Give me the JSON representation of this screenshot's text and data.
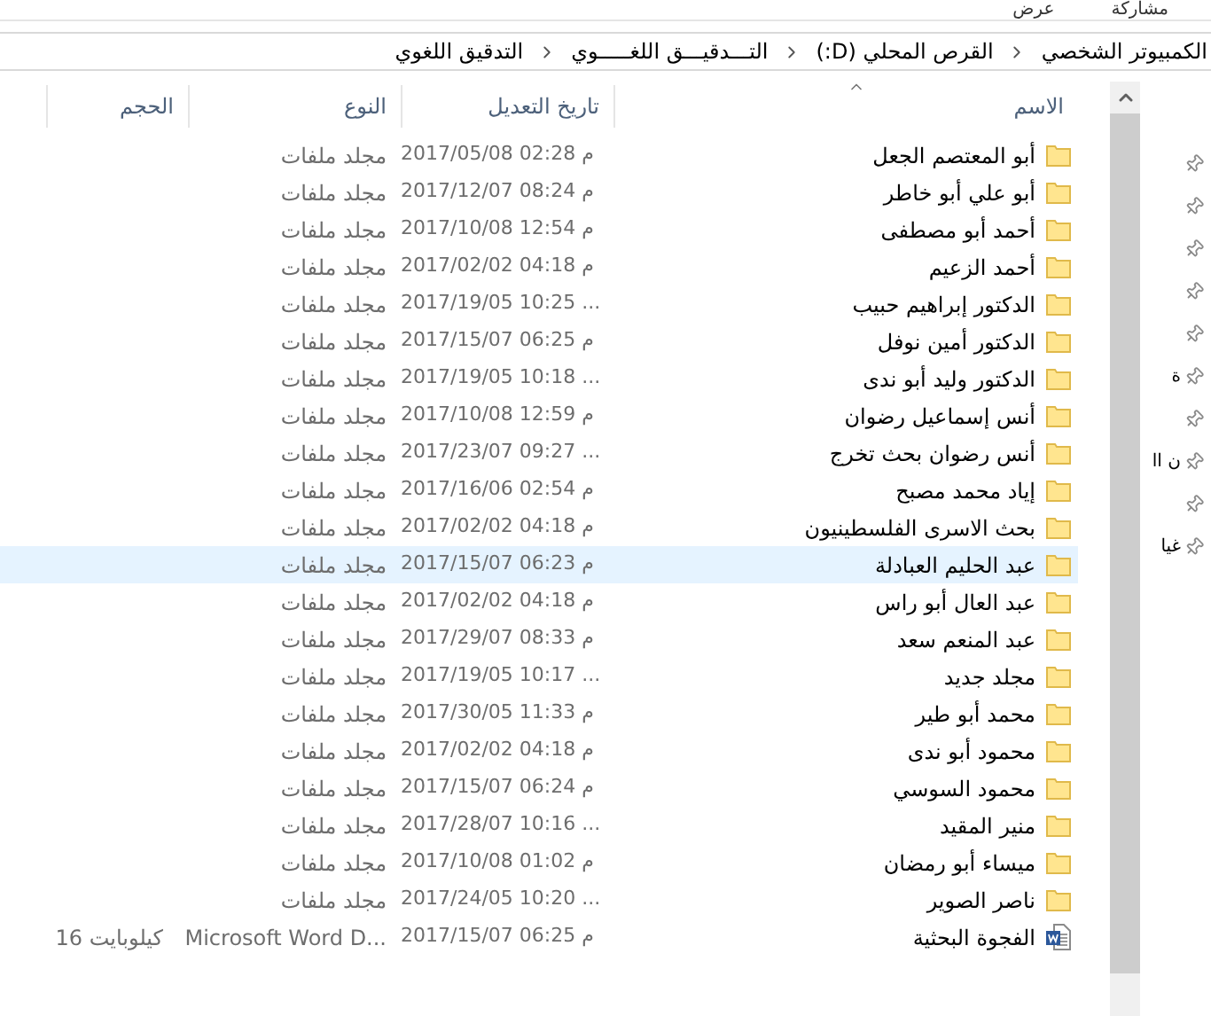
{
  "ribbon_tabs": [
    "مشاركة",
    "عرض"
  ],
  "breadcrumb": [
    "الكمبيوتر الشخصي",
    "القرص المحلي (D:)",
    "التـــدقيـــق اللغـــــوي",
    "التدقيق اللغوي"
  ],
  "columns": [
    {
      "label": "الاسم",
      "sorted": true
    },
    {
      "label": "تاريخ التعديل",
      "sorted": false
    },
    {
      "label": "النوع",
      "sorted": false
    },
    {
      "label": "الحجم",
      "sorted": false
    }
  ],
  "rows": [
    {
      "kind": "folder",
      "name": "أبو المعتصم الجعل",
      "modified": "2017/05/08 م 02:28",
      "type": "مجلد ملفات",
      "selected": false
    },
    {
      "kind": "folder",
      "name": "أبو علي أبو خاطر",
      "modified": "2017/12/07 م 08:24",
      "type": "مجلد ملفات",
      "selected": false
    },
    {
      "kind": "folder",
      "name": "أحمد أبو مصطفى",
      "modified": "2017/10/08 م 12:54",
      "type": "مجلد ملفات",
      "selected": false
    },
    {
      "kind": "folder",
      "name": "أحمد الزعيم",
      "modified": "2017/02/02 م 04:18",
      "type": "مجلد ملفات",
      "selected": false
    },
    {
      "kind": "folder",
      "name": "الدكتور إبراهيم حبيب",
      "modified": "2017/19/05 10:25 ...",
      "type": "مجلد ملفات",
      "selected": false
    },
    {
      "kind": "folder",
      "name": "الدكتور أمين نوفل",
      "modified": "2017/15/07 م 06:25",
      "type": "مجلد ملفات",
      "selected": false
    },
    {
      "kind": "folder",
      "name": "الدكتور وليد أبو ندى",
      "modified": "2017/19/05 10:18 ...",
      "type": "مجلد ملفات",
      "selected": false
    },
    {
      "kind": "folder",
      "name": "أنس إسماعيل رضوان",
      "modified": "2017/10/08 م 12:59",
      "type": "مجلد ملفات",
      "selected": false
    },
    {
      "kind": "folder",
      "name": "أنس رضوان بحث تخرج",
      "modified": "2017/23/07 09:27 ...",
      "type": "مجلد ملفات",
      "selected": false
    },
    {
      "kind": "folder",
      "name": "إياد محمد مصبح",
      "modified": "2017/16/06 م 02:54",
      "type": "مجلد ملفات",
      "selected": false
    },
    {
      "kind": "folder",
      "name": "بحث الاسرى الفلسطينيون",
      "modified": "2017/02/02 م 04:18",
      "type": "مجلد ملفات",
      "selected": false
    },
    {
      "kind": "folder",
      "name": "عبد الحليم العبادلة",
      "modified": "2017/15/07 م 06:23",
      "type": "مجلد ملفات",
      "selected": true
    },
    {
      "kind": "folder",
      "name": "عبد العال أبو راس",
      "modified": "2017/02/02 م 04:18",
      "type": "مجلد ملفات",
      "selected": false
    },
    {
      "kind": "folder",
      "name": "عبد المنعم سعد",
      "modified": "2017/29/07 م 08:33",
      "type": "مجلد ملفات",
      "selected": false
    },
    {
      "kind": "folder",
      "name": "مجلد جديد",
      "modified": "2017/19/05 10:17 ...",
      "type": "مجلد ملفات",
      "selected": false
    },
    {
      "kind": "folder",
      "name": "محمد أبو طير",
      "modified": "2017/30/05 م 11:33",
      "type": "مجلد ملفات",
      "selected": false
    },
    {
      "kind": "folder",
      "name": "محمود أبو ندى",
      "modified": "2017/02/02 م 04:18",
      "type": "مجلد ملفات",
      "selected": false
    },
    {
      "kind": "folder",
      "name": "محمود السوسي",
      "modified": "2017/15/07 م 06:24",
      "type": "مجلد ملفات",
      "selected": false
    },
    {
      "kind": "folder",
      "name": "منير المقيد",
      "modified": "2017/28/07 10:16 ...",
      "type": "مجلد ملفات",
      "selected": false
    },
    {
      "kind": "folder",
      "name": "ميساء أبو رمضان",
      "modified": "2017/10/08 م 01:02",
      "type": "مجلد ملفات",
      "selected": false
    },
    {
      "kind": "folder",
      "name": "ناصر الصوير",
      "modified": "2017/24/05 10:20 ...",
      "type": "مجلد ملفات",
      "selected": false
    },
    {
      "kind": "document",
      "name": "الفجوة البحثية",
      "modified": "2017/15/07 م 06:25",
      "type": "Microsoft Word D...",
      "size": "16 كيلوبايت",
      "selected": false
    }
  ],
  "nav_pane": [
    {
      "pinned": true
    },
    {
      "pinned": true
    },
    {
      "pinned": true
    },
    {
      "pinned": true
    },
    {
      "pinned": true
    },
    {
      "pinned": true,
      "label": "ة"
    },
    {
      "pinned": true
    },
    {
      "pinned": true,
      "label": "ن اا"
    },
    {
      "pinned": true
    },
    {
      "pinned": true,
      "label": "غيا"
    }
  ]
}
